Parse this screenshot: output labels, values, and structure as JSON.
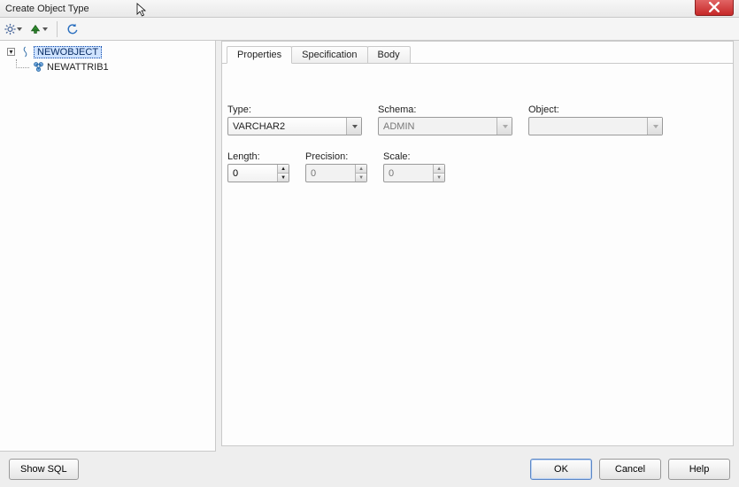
{
  "window": {
    "title": "Create Object Type"
  },
  "tree": {
    "root": {
      "label": "NEWOBJECT"
    },
    "child": {
      "label": "NEWATTRIB1"
    }
  },
  "tabs": {
    "properties": "Properties",
    "specification": "Specification",
    "body": "Body"
  },
  "form": {
    "type": {
      "label": "Type:",
      "value": "VARCHAR2"
    },
    "schema": {
      "label": "Schema:",
      "value": "ADMIN"
    },
    "object": {
      "label": "Object:",
      "value": ""
    },
    "length": {
      "label": "Length:",
      "value": "0"
    },
    "precision": {
      "label": "Precision:",
      "value": "0"
    },
    "scale": {
      "label": "Scale:",
      "value": "0"
    }
  },
  "buttons": {
    "show_sql": "Show SQL",
    "ok": "OK",
    "cancel": "Cancel",
    "help": "Help"
  },
  "icons": {
    "gear": "gear-icon",
    "add": "add-icon",
    "refresh": "refresh-icon",
    "close": "close-icon"
  }
}
